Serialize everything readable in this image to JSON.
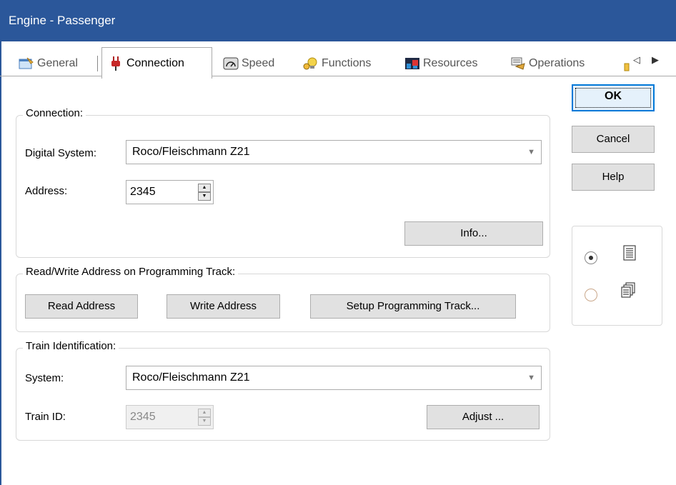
{
  "window": {
    "title": "Engine - Passenger"
  },
  "tabs": [
    {
      "label": "General",
      "icon": "general-icon"
    },
    {
      "label": "Connection",
      "icon": "plug-icon",
      "active": true
    },
    {
      "label": "Speed",
      "icon": "speedometer-icon"
    },
    {
      "label": "Functions",
      "icon": "bulb-icon"
    },
    {
      "label": "Resources",
      "icon": "resources-icon"
    },
    {
      "label": "Operations",
      "icon": "operations-icon"
    }
  ],
  "connection": {
    "group_title": "Connection:",
    "digital_system_label": "Digital System:",
    "digital_system_value": "Roco/Fleischmann Z21",
    "address_label": "Address:",
    "address_value": "2345",
    "info_button": "Info..."
  },
  "programming": {
    "group_title": "Read/Write Address on Programming Track:",
    "read_button": "Read Address",
    "write_button": "Write Address",
    "setup_button": "Setup Programming Track..."
  },
  "train_id": {
    "group_title": "Train Identification:",
    "system_label": "System:",
    "system_value": "Roco/Fleischmann Z21",
    "train_id_label": "Train ID:",
    "train_id_value": "2345",
    "adjust_button": "Adjust ..."
  },
  "buttons": {
    "ok": "OK",
    "cancel": "Cancel",
    "help": "Help"
  },
  "view_mode": {
    "options": [
      {
        "icon": "single-page-icon",
        "selected": true
      },
      {
        "icon": "multi-page-icon",
        "selected": false
      }
    ]
  },
  "colors": {
    "titlebar": "#2b579a",
    "ok_border": "#0078d7"
  }
}
